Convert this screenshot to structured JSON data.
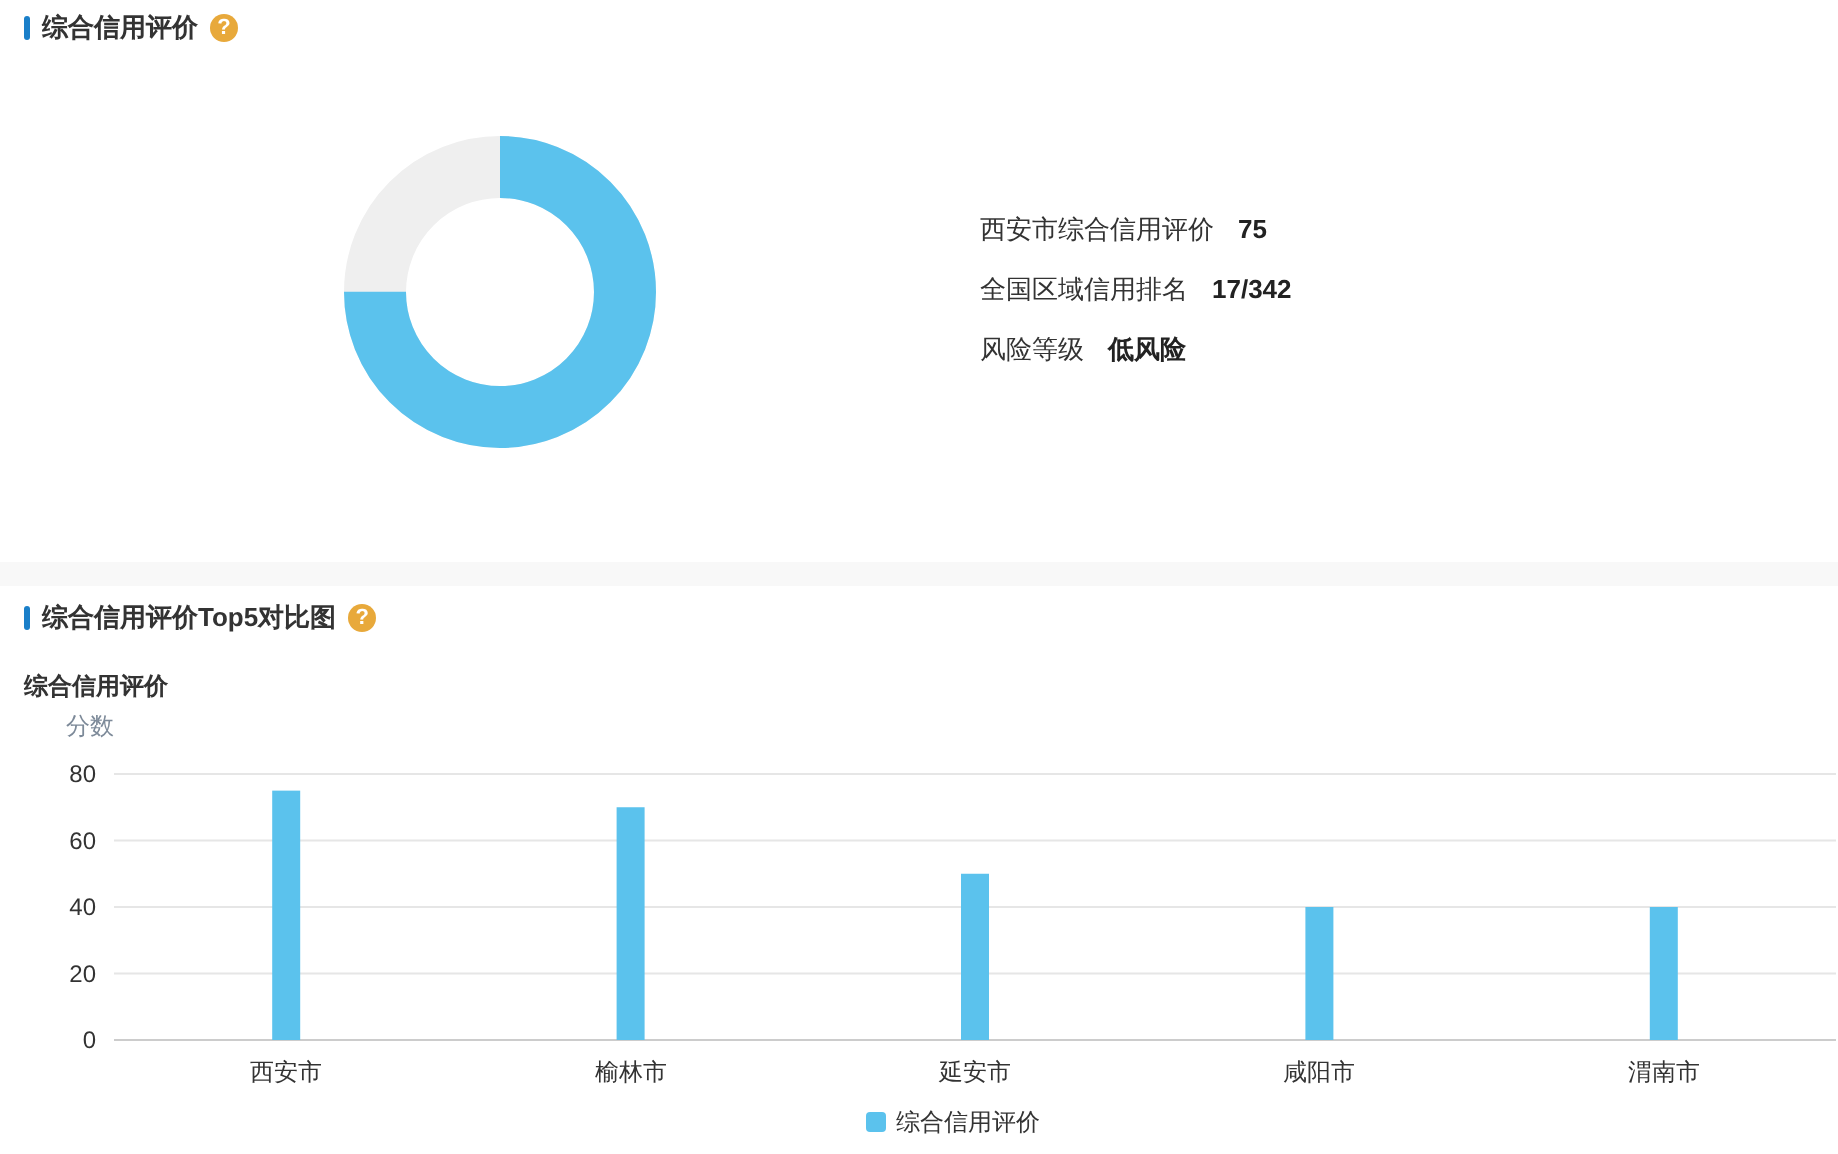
{
  "overview": {
    "title": "综合信用评价",
    "help_icon": "?",
    "score_ring": {
      "level": 0.75
    },
    "facts": [
      {
        "label": "西安市综合信用评价",
        "value": "75"
      },
      {
        "label": "全国区域信用排名",
        "value": "17/342"
      },
      {
        "label": "风险等级",
        "value": "低风险"
      }
    ]
  },
  "comparison": {
    "title": "综合信用评价Top5对比图",
    "help_icon": "?",
    "chart_data": {
      "type": "bar",
      "title": "综合信用评价",
      "ylabel": "分数",
      "categories": [
        "西安市",
        "榆林市",
        "延安市",
        "咸阳市",
        "渭南市"
      ],
      "series": [
        {
          "name": "综合信用评价",
          "color": "#5bc2ed",
          "values": [
            75,
            70,
            50,
            40,
            40
          ]
        }
      ],
      "ylim": [
        0,
        80
      ],
      "grid": true,
      "yticks": [
        0,
        20,
        40,
        60,
        80
      ]
    }
  }
}
